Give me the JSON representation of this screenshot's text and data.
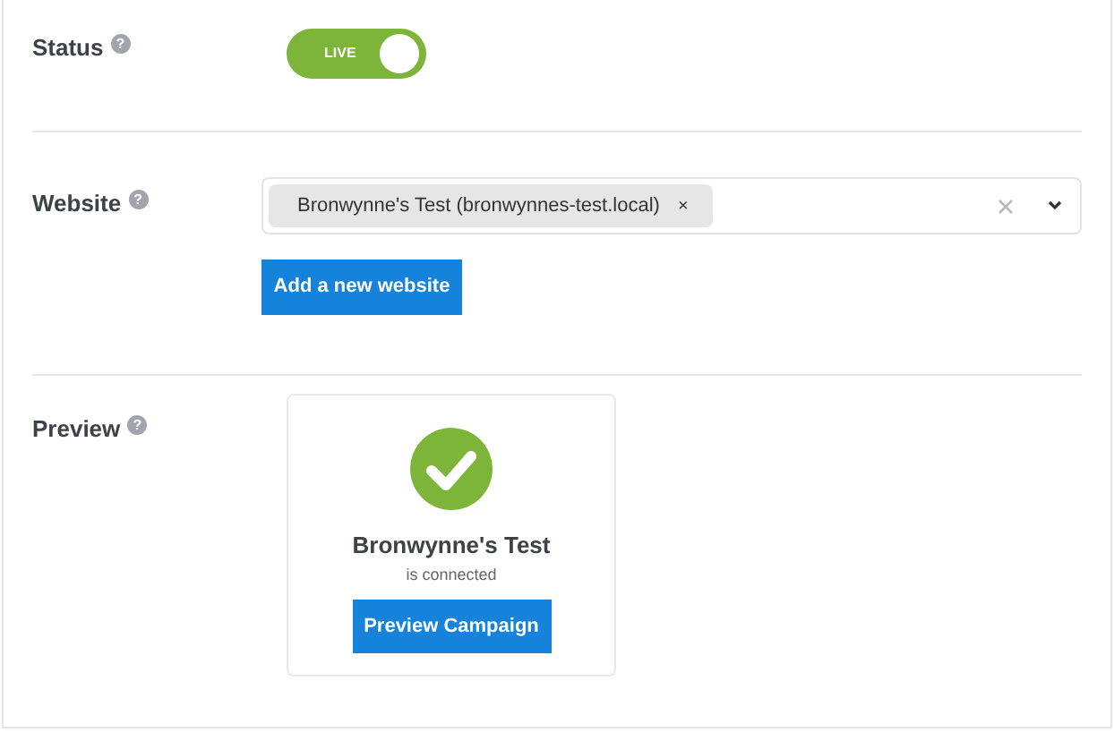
{
  "status": {
    "label": "Status",
    "help": "?",
    "toggle": {
      "label": "LIVE",
      "on": true
    }
  },
  "website": {
    "label": "Website",
    "help": "?",
    "tags": [
      {
        "text": "Bronwynne's Test (bronwynnes-test.local)",
        "remove": "×"
      }
    ],
    "add_button": "Add a new website"
  },
  "preview": {
    "label": "Preview",
    "help": "?",
    "site_name": "Bronwynne's Test",
    "note": "is connected",
    "button": "Preview Campaign"
  }
}
